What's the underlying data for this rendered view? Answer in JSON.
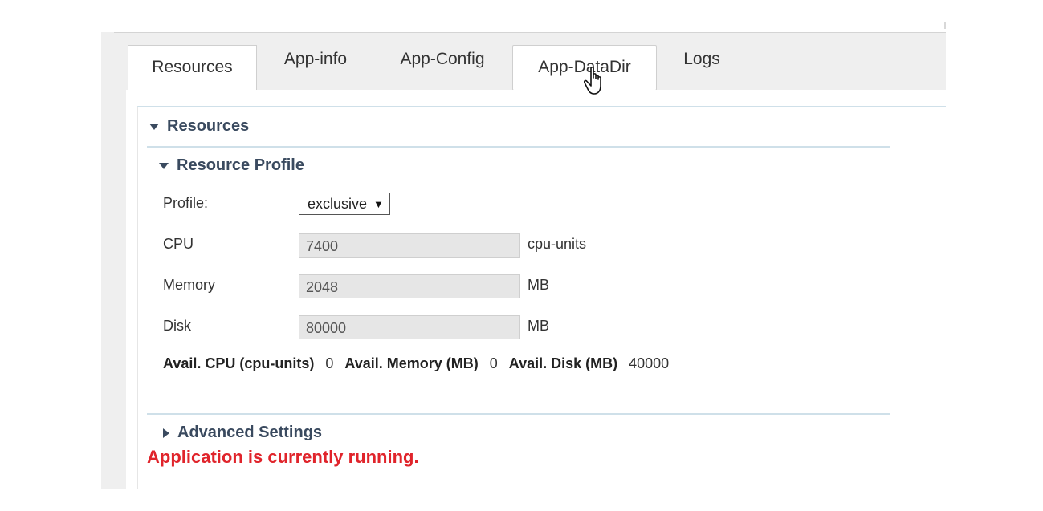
{
  "tabs": [
    {
      "label": "Resources",
      "active": true
    },
    {
      "label": "App-info",
      "active": false
    },
    {
      "label": "App-Config",
      "active": false
    },
    {
      "label": "App-DataDir",
      "active": false,
      "hovered": true
    },
    {
      "label": "Logs",
      "active": false
    }
  ],
  "sections": {
    "resources": {
      "title": "Resources",
      "expanded": true
    },
    "resource_profile": {
      "title": "Resource Profile",
      "expanded": true
    },
    "advanced": {
      "title": "Advanced Settings",
      "expanded": false
    }
  },
  "form": {
    "profile": {
      "label": "Profile:",
      "value": "exclusive"
    },
    "cpu": {
      "label": "CPU",
      "value": "7400",
      "unit": "cpu-units"
    },
    "memory": {
      "label": "Memory",
      "value": "2048",
      "unit": "MB"
    },
    "disk": {
      "label": "Disk",
      "value": "80000",
      "unit": "MB"
    }
  },
  "availability": {
    "cpu_label": "Avail. CPU (cpu-units)",
    "cpu_value": "0",
    "memory_label": "Avail. Memory (MB)",
    "memory_value": "0",
    "disk_label": "Avail. Disk (MB)",
    "disk_value": "40000"
  },
  "status": {
    "message": "Application is currently running.",
    "color": "#e0242b"
  },
  "colors": {
    "heading": "#3a4a5f",
    "rule": "#cfe0e9",
    "panel": "#efefef"
  },
  "icons": {
    "cursor": "hand-pointer-icon",
    "expanded": "triangle-down-icon",
    "collapsed": "triangle-right-icon"
  }
}
